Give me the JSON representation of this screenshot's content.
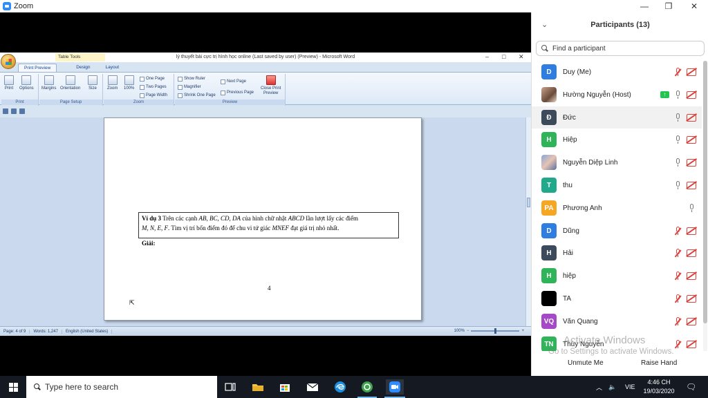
{
  "zoom": {
    "title": "Zoom",
    "controls": {
      "minimize": "—",
      "restore": "❐",
      "close": "✕"
    }
  },
  "word": {
    "doc_title": "lý thuyết bài cực trị hình học online (Last saved by user) (Preview) - Microsoft Word",
    "contextual_tab": "Table Tools",
    "tabs": [
      "Print Preview",
      "Design",
      "Layout"
    ],
    "ribbon": {
      "print_group": {
        "label": "Print",
        "buttons": [
          "Print",
          "Options"
        ]
      },
      "page_setup_group": {
        "label": "Page Setup",
        "buttons": [
          "Margins",
          "Orientation",
          "Size"
        ]
      },
      "zoom_group": {
        "label": "Zoom",
        "buttons": [
          "Zoom",
          "100%"
        ],
        "small": [
          "One Page",
          "Two Pages",
          "Page Width"
        ]
      },
      "preview_group": {
        "label": "Preview",
        "checks": [
          "Show Ruler",
          "Magnifier",
          "Shrink One Page"
        ],
        "nav": [
          "Next Page",
          "Previous Page"
        ],
        "close": [
          "Close Print",
          "Preview"
        ]
      }
    },
    "page": {
      "example_label": "Ví dụ 3",
      "line1_a": " Trên các cạnh ",
      "line1_b": "AB, BC, CD, DA",
      "line1_c": " của hình chữ nhật ",
      "line1_d": "ABCD",
      "line1_e": " lần lượt lấy các điểm",
      "line2_a": "M, N, E, F",
      "line2_b": ". Tìm vị trí bốn điểm đó để chu vi tứ giác ",
      "line2_c": "MNEF",
      "line2_d": " đạt giá trị nhỏ nhất.",
      "solution": "Giải:",
      "page_number": "4"
    },
    "status": {
      "page": "Page: 4 of 9",
      "words": "Words: 1,247",
      "language": "English (United States)",
      "zoom": "100%"
    }
  },
  "participants": {
    "header": "Participants (13)",
    "search_placeholder": "Find a participant",
    "list": [
      {
        "initials": "D",
        "name": "Duy (Me)",
        "color": "#2f7de1",
        "mic": "muted",
        "cam": "off"
      },
      {
        "initials": "",
        "name": "Hường Nguyễn (Host)",
        "color": "",
        "mic": "on",
        "cam": "off",
        "sharing": true
      },
      {
        "initials": "Đ",
        "name": "Đức",
        "color": "#3d4a5c",
        "mic": "on",
        "cam": "off"
      },
      {
        "initials": "H",
        "name": "Hiệp",
        "color": "#2fb45a",
        "mic": "on",
        "cam": "off"
      },
      {
        "initials": "",
        "name": "Nguyễn Diệp Linh",
        "color": "",
        "mic": "on",
        "cam": "off"
      },
      {
        "initials": "T",
        "name": "thu",
        "color": "#22a88a",
        "mic": "on",
        "cam": "off"
      },
      {
        "initials": "PA",
        "name": "Phương Anh",
        "color": "#f5a623",
        "mic": "on",
        "cam": "none"
      },
      {
        "initials": "D",
        "name": "Dũng",
        "color": "#2f7de1",
        "mic": "muted",
        "cam": "off"
      },
      {
        "initials": "H",
        "name": "Hải",
        "color": "#3d4a5c",
        "mic": "muted",
        "cam": "off"
      },
      {
        "initials": "H",
        "name": "hiệp",
        "color": "#2fb45a",
        "mic": "muted",
        "cam": "off"
      },
      {
        "initials": "",
        "name": "TA",
        "color": "#000000",
        "mic": "muted",
        "cam": "off"
      },
      {
        "initials": "VQ",
        "name": "Văn Quang",
        "color": "#a549c9",
        "mic": "muted",
        "cam": "off"
      },
      {
        "initials": "TN",
        "name": "Thùy Nguyễn",
        "color": "#2fb45a",
        "mic": "muted",
        "cam": "off"
      }
    ],
    "footer": {
      "unmute": "Unmute Me",
      "raise_hand": "Raise Hand"
    }
  },
  "watermark": {
    "line1": "Activate Windows",
    "line2": "Go to Settings to activate Windows."
  },
  "taskbar": {
    "search_placeholder": "Type here to search",
    "tray_lang": "VIE",
    "time": "4:46 CH",
    "date": "19/03/2020"
  }
}
